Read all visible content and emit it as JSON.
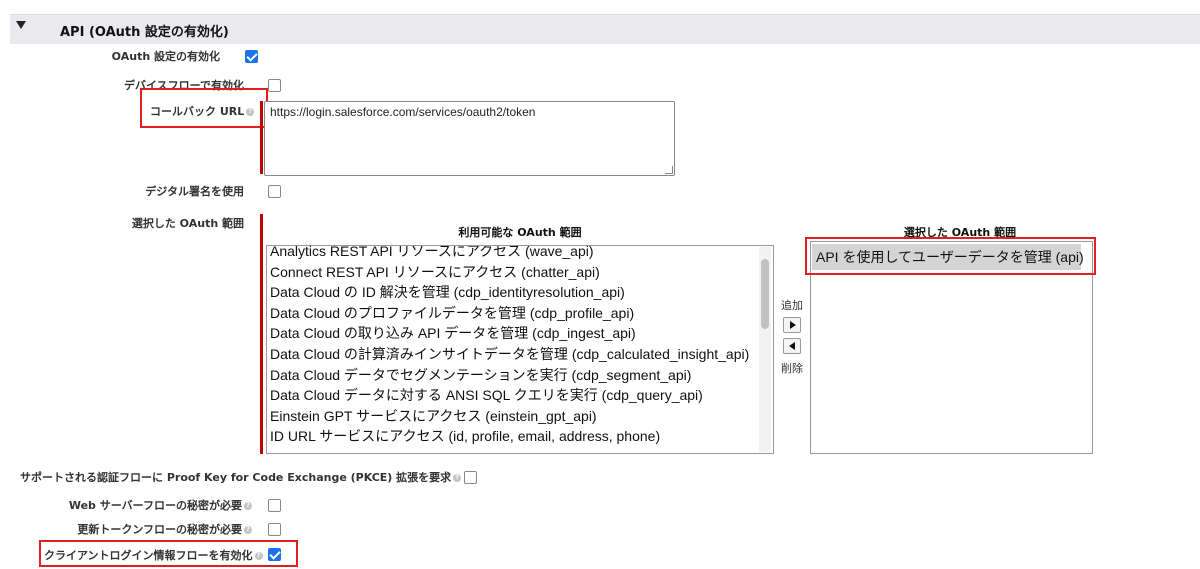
{
  "section": {
    "title": "API (OAuth 設定の有効化)"
  },
  "fields": {
    "enable_oauth": {
      "label": "OAuth 設定の有効化",
      "checked": true
    },
    "device_flow": {
      "label": "デバイスフローで有効化",
      "checked": false
    },
    "callback_url": {
      "label": "コールバック URL",
      "value": "https://login.salesforce.com/services/oauth2/token"
    },
    "digital_signature": {
      "label": "デジタル署名を使用",
      "checked": false
    },
    "selected_scopes": {
      "label": "選択した OAuth 範囲"
    },
    "pkce": {
      "label": "サポートされる認証フローに Proof Key for Code Exchange (PKCE) 拡張を要求",
      "checked": false
    },
    "web_server_secret": {
      "label": "Web サーバーフローの秘密が必要",
      "checked": false
    },
    "refresh_token_secret": {
      "label": "更新トークンフローの秘密が必要",
      "checked": false
    },
    "client_credentials": {
      "label": "クライアントログイン情報フローを有効化",
      "checked": true
    }
  },
  "available_scopes": {
    "title": "利用可能な OAuth 範囲",
    "items": [
      "Analytics REST API リソースにアクセス (wave_api)",
      "Connect REST API リソースにアクセス (chatter_api)",
      "Data Cloud の ID 解決を管理 (cdp_identityresolution_api)",
      "Data Cloud のプロファイルデータを管理 (cdp_profile_api)",
      "Data Cloud の取り込み API データを管理 (cdp_ingest_api)",
      "Data Cloud の計算済みインサイトデータを管理 (cdp_calculated_insight_api)",
      "Data Cloud データでセグメンテーションを実行 (cdp_segment_api)",
      "Data Cloud データに対する ANSI SQL クエリを実行 (cdp_query_api)",
      "Einstein GPT サービスにアクセス (einstein_gpt_api)",
      "ID URL サービスにアクセス (id, profile, email, address, phone)"
    ]
  },
  "selected_scopes_list": {
    "title": "選択した OAuth 範囲",
    "items": [
      "API を使用してユーザーデータを管理 (api)"
    ]
  },
  "buttons": {
    "add_label": "追加",
    "remove_label": "削除"
  },
  "colors": {
    "highlight_red": "#e02020",
    "required_bar": "#c00000",
    "checkbox_blue": "#1a73e8"
  }
}
